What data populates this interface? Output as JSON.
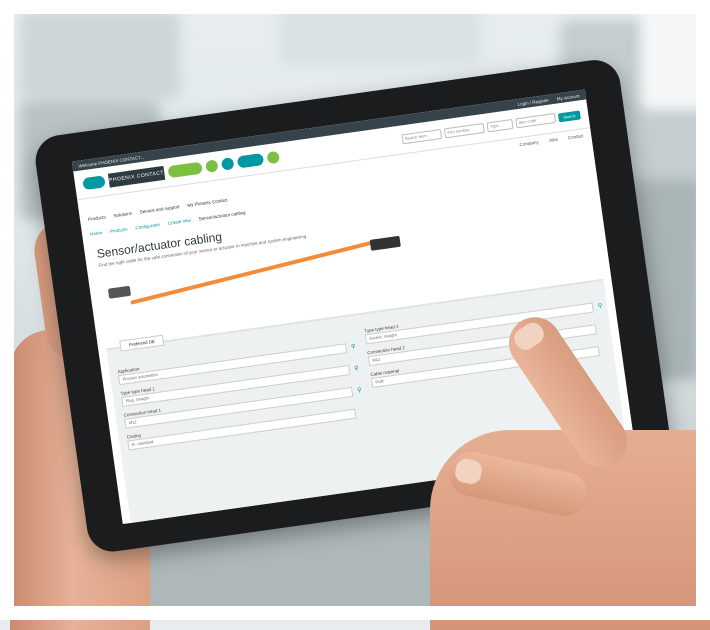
{
  "tablet_screen": {
    "topbar_left": "Welcome PHOENIX CONTACT...",
    "topbar_right": [
      "Login / Register",
      "My account"
    ],
    "logo_text": "PHOENIX CONTACT",
    "search_placeholders": [
      "Search term",
      "Part number",
      "Type",
      "Item code"
    ],
    "search_button": "Search",
    "top_links": [
      "Company",
      "Jobs",
      "Contact"
    ],
    "nav_items": [
      "Products",
      "Solutions",
      "Service and support",
      "My Phoenix Contact"
    ],
    "subnav_items": [
      "Home",
      "Products",
      "Configurator",
      "Create new",
      "Sensor/actuator cabling"
    ],
    "headline": "Sensor/actuator cabling",
    "subtitle": "Find the right cable for the safe connection of your sensor or actuator in machine and system engineering",
    "panel_tab": "Preferred DE",
    "fields_left": [
      {
        "label": "Application",
        "value": "Process automation"
      },
      {
        "label": "Type type head 1",
        "value": "Plug, straight"
      },
      {
        "label": "Connection head 1",
        "value": "M12"
      },
      {
        "label": "Coding",
        "value": "A - standard"
      }
    ],
    "fields_right": [
      {
        "label": "Type type head 2",
        "value": "Socket, straight"
      },
      {
        "label": "Connection head 2",
        "value": "M12"
      },
      {
        "label": "Cable material",
        "value": "PUR"
      }
    ]
  },
  "colors": {
    "accent_teal": "#0098a1",
    "accent_green": "#7ac142",
    "cable_orange": "#f08c3a",
    "tablet_bezel": "#1a1c1e"
  }
}
